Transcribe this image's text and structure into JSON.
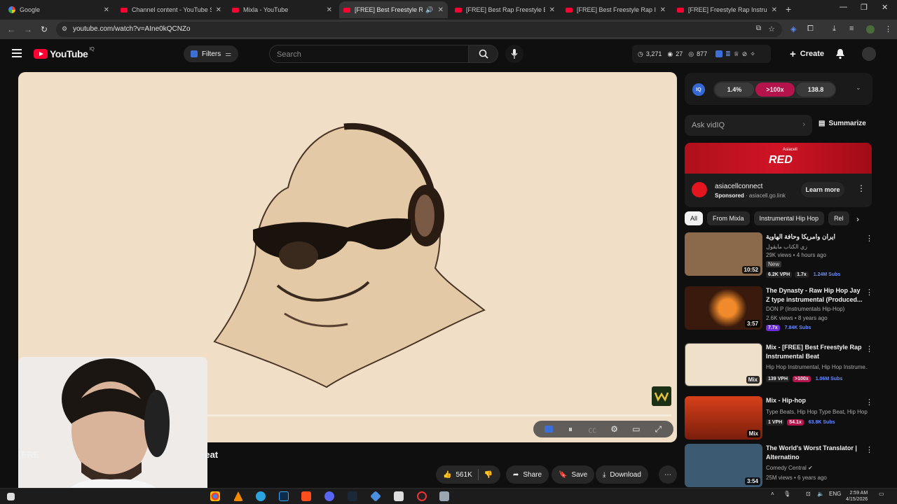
{
  "browser": {
    "tabs": [
      {
        "title": "Google",
        "kind": "google"
      },
      {
        "title": "Channel content - YouTube Stu",
        "kind": "yt"
      },
      {
        "title": "Mixla - YouTube",
        "kind": "yt"
      },
      {
        "title": "[FREE] Best Freestyle Rap I",
        "kind": "yt",
        "active": true
      },
      {
        "title": "[FREE] Best Rap Freestyle Batt",
        "kind": "yt"
      },
      {
        "title": "[FREE] Best Freestyle Rap Instru",
        "kind": "yt"
      },
      {
        "title": "[FREE] Freestyle Rap Instrumen",
        "kind": "yt"
      }
    ],
    "url": "youtube.com/watch?v=AIne0kQCNZo"
  },
  "header": {
    "logo_text": "YouTube",
    "logo_sup": "IQ",
    "filters_label": "Filters",
    "search_placeholder": "Search",
    "stats": {
      "a": "3,271",
      "b": "27",
      "c": "877"
    },
    "create_label": "Create"
  },
  "player": {
    "progress_fraction": 0.063,
    "overlay_title_start": "[FRE",
    "overlay_title_end": "eat"
  },
  "actions": {
    "likes": "561K",
    "share": "Share",
    "save": "Save",
    "download": "Download"
  },
  "vidiq": {
    "pill1": "1.4%",
    "pill2": ">100x",
    "pill3": "138.8",
    "ask_placeholder": "Ask vidIQ",
    "summarize": "Summarize",
    "logo": "IQ"
  },
  "ad": {
    "banner_word": "RED",
    "banner_brand": "Asiacell",
    "name": "asiacellconnect",
    "sponsored": "Sponsored",
    "domain": "asiacell.go.link",
    "learn_more": "Learn more"
  },
  "chips": [
    "All",
    "From Mixla",
    "Instrumental Hip Hop",
    "Rel"
  ],
  "recommendations": [
    {
      "title": "ايران وامريكا وحافة الهاوية",
      "channel": "زي الكتاب مايقول",
      "meta": "29K views • 4 hours ago",
      "new": "New",
      "duration": "10:52",
      "badges": [
        "6.2K VPH",
        "1.7x",
        "1.24M Subs"
      ],
      "thumb": "#8a6a4a"
    },
    {
      "title": "The Dynasty - Raw Hip Hop Jay Z type instrumental (Produced...",
      "channel": "DON P (Instrumentals Hip-Hop)",
      "meta": "2.6K views • 8 years ago",
      "duration": "3:57",
      "badges": [
        "7.7x",
        "7.84K Subs"
      ],
      "thumb": "#3a1a0c"
    },
    {
      "title": "Mix - [FREE] Best Freestyle Rap Instrumental Beat",
      "channel": "Hip Hop Instrumental, Hip Hop Instrume...",
      "meta": "",
      "duration": "Mix",
      "badges": [
        "139 VPH",
        ">100x",
        "1.06M Subs"
      ],
      "thumb": "#efe0c9"
    },
    {
      "title": "Mix - Hip-hop",
      "channel": "Type Beats, Hip Hop Type Beat, Hip Hop ...",
      "meta": "",
      "duration": "Mix",
      "badges": [
        "1 VPH",
        "54.1x",
        "63.8K Subs"
      ],
      "thumb": "#9b2b12"
    },
    {
      "title": "The World's Worst Translator | Alternatino",
      "channel": "Comedy Central",
      "meta": "25M views • 6 years ago",
      "duration": "3:54",
      "badges": [],
      "thumb": "#3c5a72"
    }
  ],
  "taskbar": {
    "lang": "ENG",
    "time": "2:59 AM",
    "date": "4/15/2026"
  }
}
